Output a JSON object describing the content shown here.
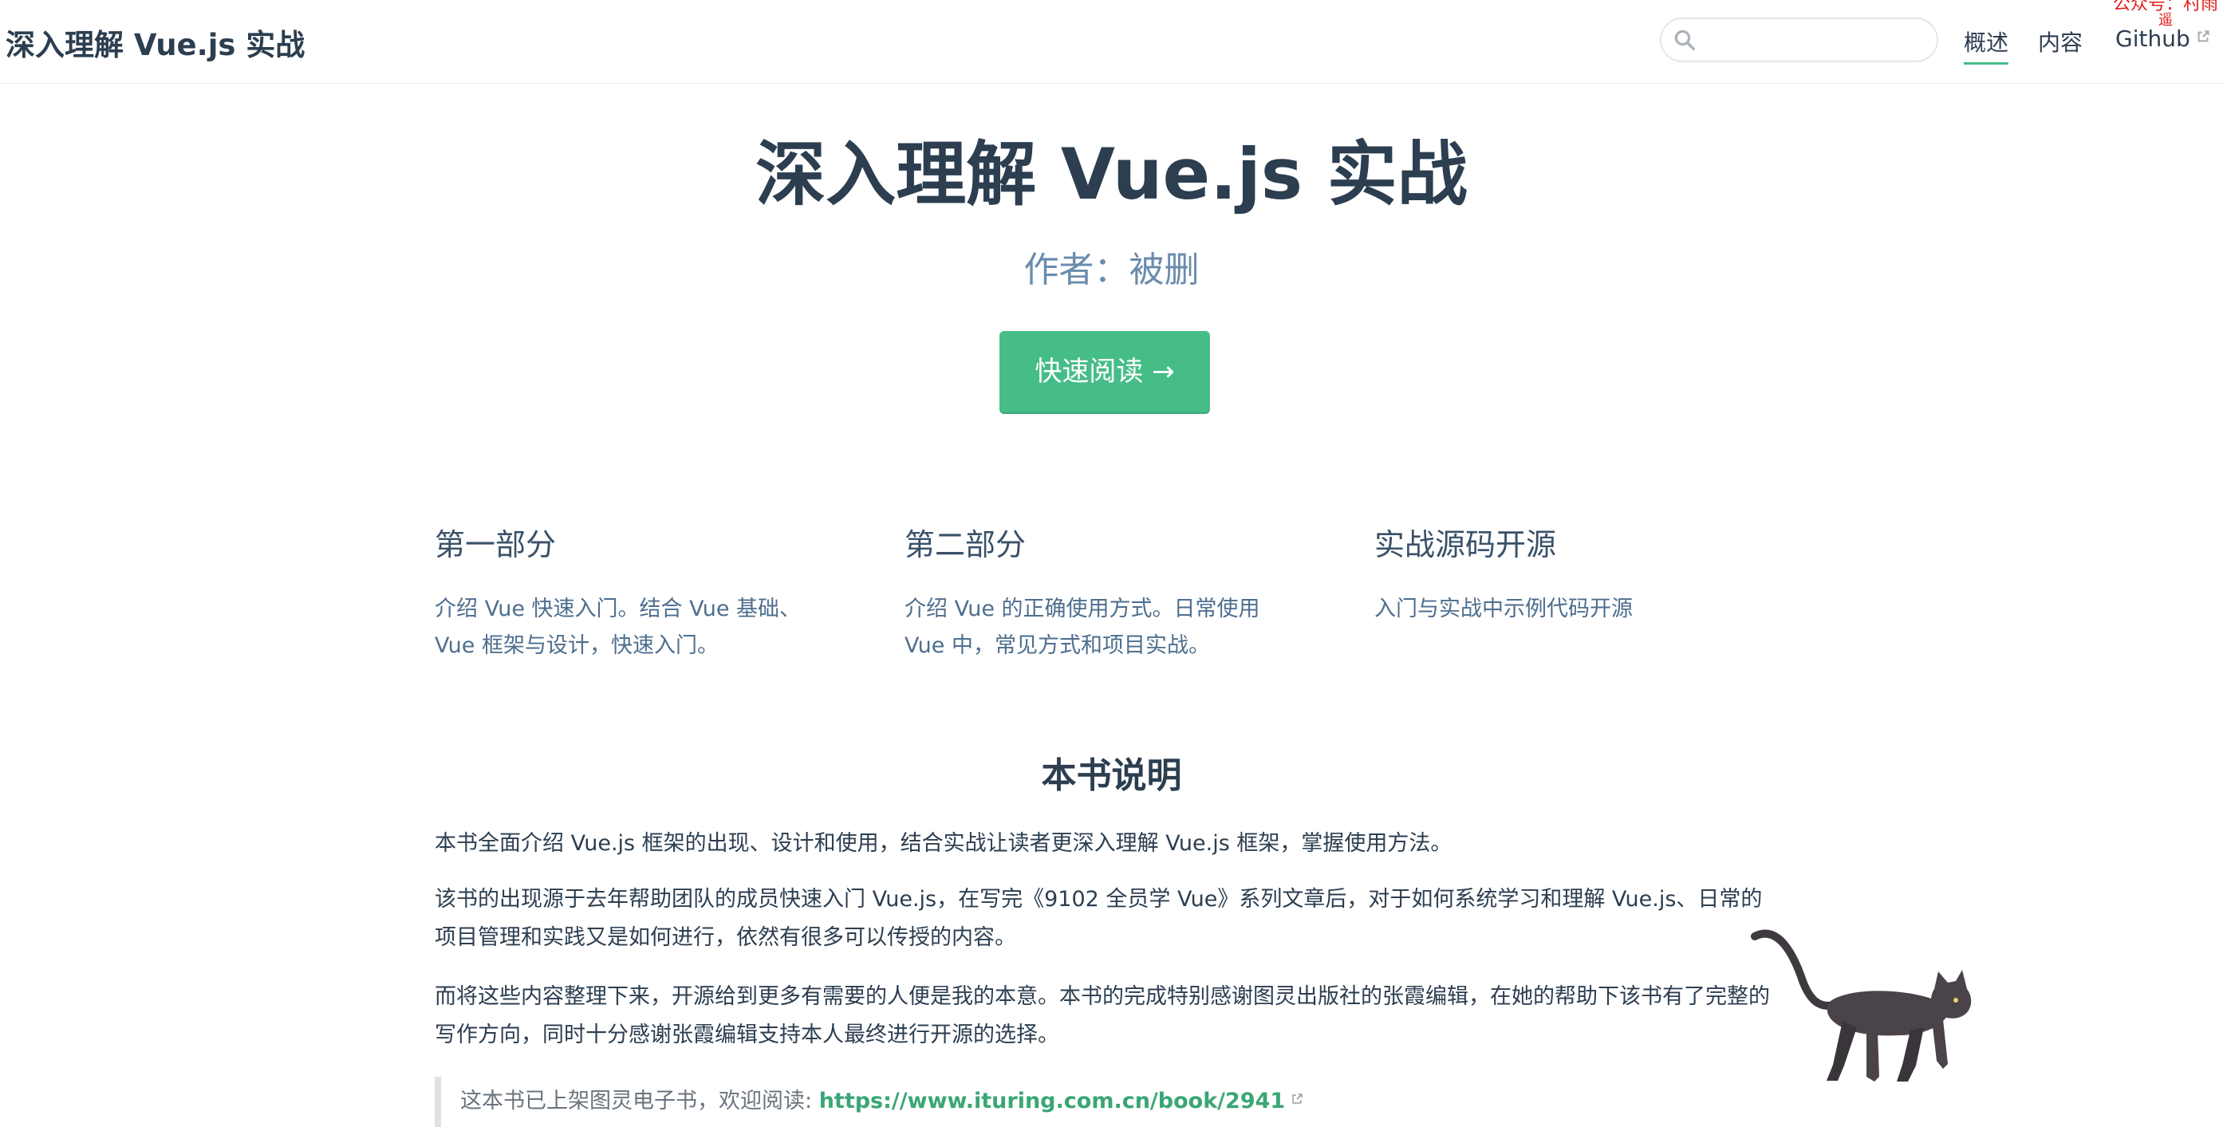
{
  "navbar": {
    "site_title": "深入理解 Vue.js 实战",
    "search_placeholder": "",
    "links": [
      {
        "label": "概述",
        "active": true
      },
      {
        "label": "内容",
        "active": false
      },
      {
        "label": "Github",
        "external": true
      }
    ],
    "watermark_line1": "公众号：村雨",
    "watermark_line2": "遥"
  },
  "hero": {
    "title": "深入理解 Vue.js 实战",
    "description": "作者：被删",
    "action_label": "快速阅读 →"
  },
  "features": [
    {
      "title": "第一部分",
      "details": "介绍 Vue 快速入门。结合 Vue 基础、Vue 框架与设计，快速入门。"
    },
    {
      "title": "第二部分",
      "details": "介绍 Vue 的正确使用方式。日常使用 Vue 中，常见方式和项目实战。"
    },
    {
      "title": "实战源码开源",
      "details": "入门与实战中示例代码开源"
    }
  ],
  "content": {
    "section_title": "本书说明",
    "paragraphs": [
      "本书全面介绍 Vue.js 框架的出现、设计和使用，结合实战让读者更深入理解 Vue.js 框架，掌握使用方法。",
      "该书的出现源于去年帮助团队的成员快速入门 Vue.js，在写完《9102 全员学 Vue》系列文章后，对于如何系统学习和理解 Vue.js、日常的项目管理和实践又是如何进行，依然有很多可以传授的内容。",
      "而将这些内容整理下来，开源给到更多有需要的人便是我的本意。本书的完成特别感谢图灵出版社的张霞编辑，在她的帮助下该书有了完整的写作方向，同时十分感谢张霞编辑支持本人最终进行开源的选择。"
    ],
    "tip_text": "这本书已上架图灵电子书，欢迎阅读: ",
    "tip_link": "https://www.ituring.com.cn/book/2941"
  },
  "colors": {
    "accent": "#46bd87",
    "text": "#2c3e50",
    "muted": "#6a8bad"
  },
  "icons": [
    "search-icon",
    "external-link-icon",
    "cat-illustration"
  ]
}
